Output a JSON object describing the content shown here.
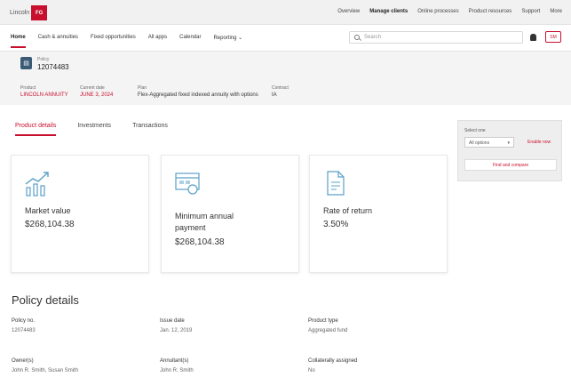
{
  "brand": {
    "name": "Lincoln",
    "badge": "FG"
  },
  "top_links": [
    "Overview",
    "Manage clients",
    "Online processes",
    "Product resources",
    "Support",
    "More"
  ],
  "top_links_active": 1,
  "nav": {
    "items": [
      "Home",
      "Cash & annuities",
      "Fixed opportunities",
      "All apps",
      "Calendar",
      "Reporting"
    ],
    "active": 0,
    "reporting_chevron": "⌄"
  },
  "search": {
    "placeholder": "Search"
  },
  "user_button": "SM",
  "policy_header": {
    "label": "Policy",
    "number": "12074483",
    "fields": [
      {
        "key": "Product",
        "value": "LINCOLN ANNUITY"
      },
      {
        "key": "Current date",
        "value": "JUNE 3, 2024"
      },
      {
        "key": "Plan",
        "value": "Flex-Aggregated fixed indexed annuity with options"
      },
      {
        "key": "Contract",
        "value": "IA"
      }
    ]
  },
  "tabs": [
    "Product details",
    "Investments",
    "Transactions"
  ],
  "tabs_active": 0,
  "cards": [
    {
      "icon": "chart-growth-icon",
      "label": "Market value",
      "value": "$268,104.38"
    },
    {
      "icon": "payment-calendar-icon",
      "label": "Minimum annual payment",
      "value": "$268,104.38"
    },
    {
      "icon": "document-rate-icon",
      "label": "Rate of return",
      "value": "3.50%"
    }
  ],
  "sidebox": {
    "label": "Select one",
    "select_value": "All options",
    "link": "Enable now",
    "button": "Find and compare"
  },
  "details": {
    "title": "Policy details",
    "fields": [
      {
        "key": "Policy no.",
        "value": "12074483"
      },
      {
        "key": "Issue date",
        "value": "Jan. 12, 2019"
      },
      {
        "key": "Product type",
        "value": "Aggregated fund"
      },
      {
        "key": "Owner(s)",
        "value": "John R. Smith, Susan Smith"
      },
      {
        "key": "Annuitant(s)",
        "value": "John R. Smith"
      },
      {
        "key": "Collaterally assigned",
        "value": "No"
      }
    ]
  }
}
